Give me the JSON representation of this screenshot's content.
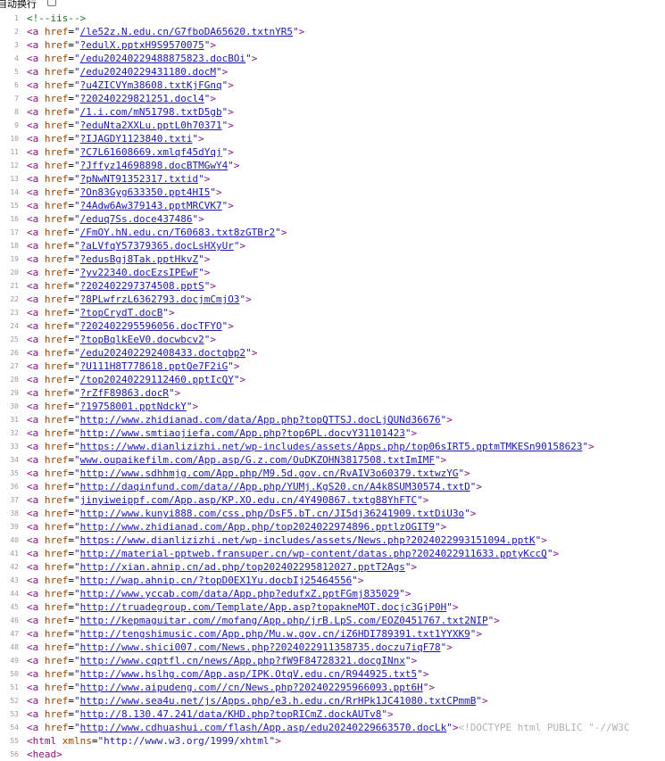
{
  "toolbar": {
    "wrap_label": "自动换行",
    "wrap_checked": false
  },
  "first_line": "<!--iis-->",
  "links": [
    "/le52z.N.edu.cn/G7fboDA65620.txtnYR5",
    "?edulX.pptxH9S9570075",
    "/edu20240229488875823.docBOi",
    "/edu20240229431180.docM",
    "?u4ZICVYm38608.txtKjFGnq",
    "?20240229821251.docl4",
    "/1.i.com/mN51798.txtD5gb",
    "?eduNta2XXLu.pptL0h70371",
    "?IJAGDY1123840.txti",
    "?C7L61608669.xmlqf45dYqj",
    "?Jffyz14698898.docBTMGwY4",
    "?pNwNT91352317.txtid",
    "?On83Gyg633350.ppt4HI5",
    "?4Adw6Aw379143.pptMRCVK7",
    "/eduq7Ss.doce437486",
    "/FmOY.hN.edu.cn/T60683.txt8zGTBr2",
    "?aLVfqY57379365.docLsHXyUr",
    "?edusBgj8Tak.pptHkvZ",
    "?yv22340.docEzsIPEwF",
    "?202402297374508.pptS",
    "?8PLwfrzL6362793.docjmCmjO3",
    "?topCrydT.docB",
    "?202402295596056.docTFYO",
    "?topBqlkEeV0.docwbcv2",
    "/edu202402292408433.doctqbp2",
    "?U111H8T778618.pptQe7F2iG",
    "/top20240229112460.pptIcQY",
    "?rZfF89863.docR",
    "?19758001.pptNdckY",
    "http://www.zhidianad.com/data/App.php?topQTTSJ.docLjQUNd36676",
    "http://www.smtiaojiefa.com/App.php?top6PL.docvY31101423",
    "https://www.dianlizizhi.net/wp-includes/assets/Apps.php/top06sIRT5.pptmTMKESn90158623",
    "www.oupaikefilm.com/App.asp/G.z.com/OuDKZOHN3817508.txtImIMF",
    "http://www.sdhhmjg.com/App.php/M9.5d.gov.cn/RvAIV3o60379.txtwzYG",
    "http://daqinfund.com/data//App.php/YUMj.KgS20.cn/A4k8SUM30574.txtD",
    "jinyiweippf.com/App.asp/KP.XO.edu.cn/4Y490867.txtg88YhFTC",
    "http://www.kunyi888.com/css.php/DsF5.bT.cn/JI5dj36241909.txtDiU3o",
    "http://www.zhidianad.com/App.php/top2024022974896.pptlzOGIT9",
    "https://www.dianlizizhi.net/wp-includes/assets/News.php?2024022993151094.pptK",
    "http://material-pptweb.fransuper.cn/wp-content/datas.php?2024022911633.pptyKccQ",
    "http://xian.ahnip.cn/ad.php/top202402295812027.pptT2Ags",
    "http://wap.ahnip.cn/?topD0EX1Yu.docbIj25464556",
    "http://www.yccab.com/data/App.php?edufxZ.pptFGmj835029",
    "http://truadegroup.com/Template/App.asp?topakneMOT.docjc3GjP0H",
    "http://kepmaguitar.com//mofang/App.php/jrB.LpS.com/EOZ0451767.txt2NIP",
    "http://tengshimusic.com/App.php/Mu.w.gov.cn/iZ6HDI789391.txt1YYXK9",
    "http://www.shici007.com/News.php?2024022911358735.doczu7iqF78",
    "http://www.cqptfl.cn/news/App.php?fW9F84728321.docgINnx",
    "http://www.hslhg.com/App.asp/IPK.OtqV.edu.cn/R944925.txt5",
    "http://www.aipudeng.com//cn/News.php?202402295966093.ppt6H",
    "http://www.sea4u.net/js/Apps.php/e3.h.edu.cn/RrHPk1JC41080.txtCPmmB",
    "http://8.130.47.241/data/KHD.php?topRICmZ.dockAUTv8",
    "http://www.cdhuashui.com/flash/App.asp/edu20240229663570.docLk"
  ],
  "doctype_tail": "<!DOCTYPE html PUBLIC \"-//W3C",
  "html_line": {
    "tag": "html",
    "attr": "xmlns",
    "value": "\"http://www.w3.org/1999/xhtml\""
  },
  "head_line": "<head>",
  "strings": {
    "a_open": "<a ",
    "href": "href",
    "eq": "=",
    "quote": "\"",
    "close": ">",
    "lt": "<",
    "gt": ">"
  }
}
